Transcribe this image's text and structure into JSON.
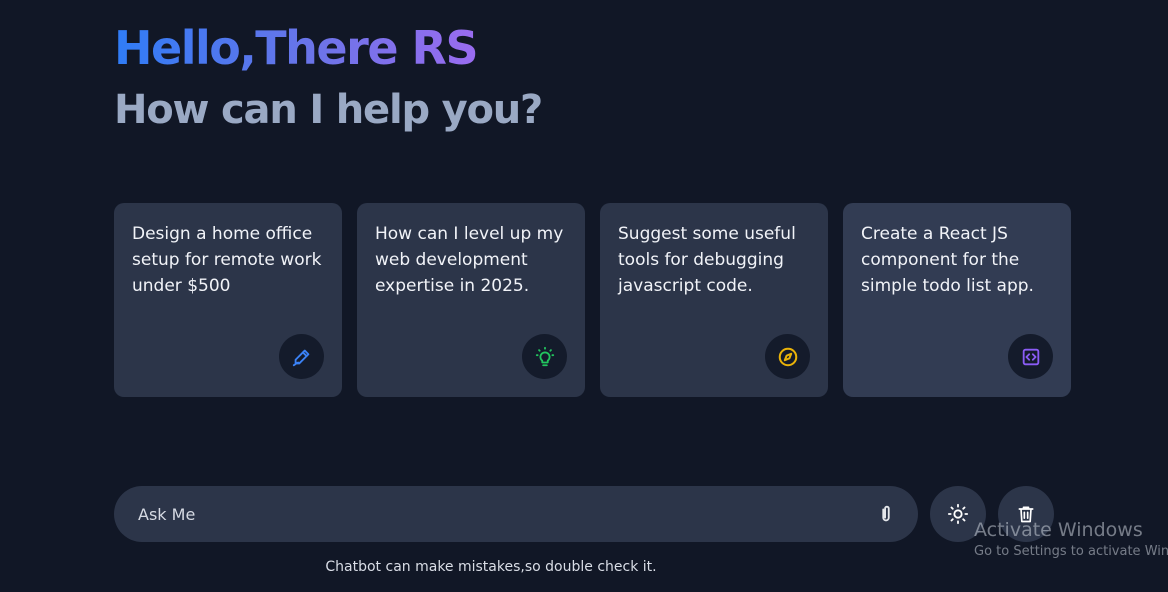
{
  "header": {
    "greeting": "Hello,There RS",
    "subtitle": "How can I help you?"
  },
  "suggestions": [
    {
      "text": "Design a home office setup for remote work under $500",
      "icon": "pen-icon",
      "icon_color": "#3b82f6"
    },
    {
      "text": "How can I level up my web development expertise in 2025.",
      "icon": "lightbulb-icon",
      "icon_color": "#22c55e"
    },
    {
      "text": "Suggest some useful tools for debugging javascript code.",
      "icon": "compass-icon",
      "icon_color": "#eab308"
    },
    {
      "text": "Create a React JS component for the simple todo list app.",
      "icon": "code-icon",
      "icon_color": "#8b5cf6"
    }
  ],
  "prompt": {
    "placeholder": "Ask Me",
    "attach_icon": "paperclip-icon"
  },
  "actions": {
    "theme_icon": "sun-icon",
    "delete_icon": "trash-icon"
  },
  "disclaimer": "Chatbot can make mistakes,so double check it.",
  "watermark": {
    "title": "Activate Windows",
    "subtitle": "Go to Settings to activate Windows."
  },
  "colors": {
    "background": "#111726",
    "card": "#2c3549",
    "gradient_start": "#2f7cf6",
    "gradient_end": "#9a6cf0",
    "subtitle": "#9aa9c4"
  }
}
